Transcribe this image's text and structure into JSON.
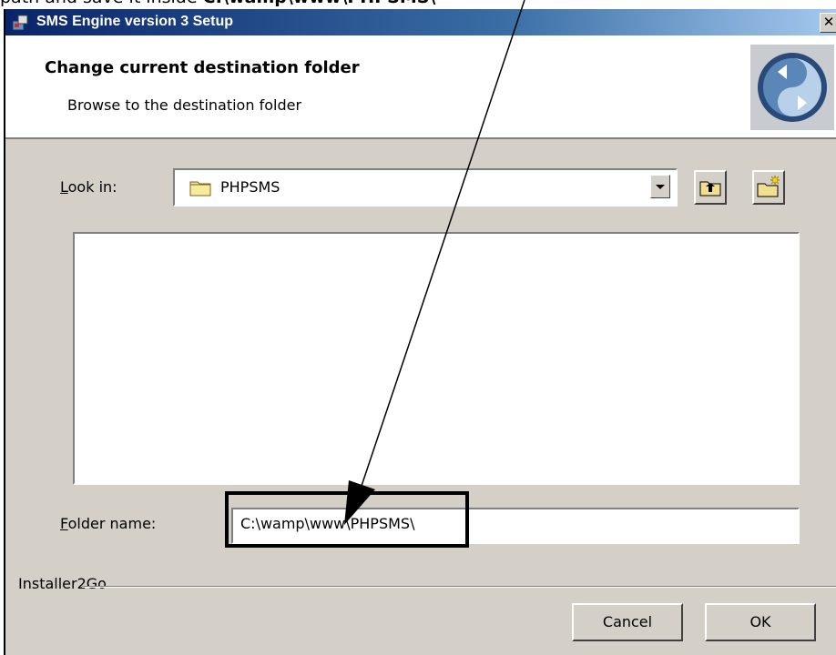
{
  "caption": {
    "prefix": "path and save it  inside  ",
    "path": "C:\\wamp\\www\\PHPSMS\\"
  },
  "window": {
    "title": "SMS Engine version 3 Setup",
    "close_glyph": "✕"
  },
  "header": {
    "title": "Change current destination folder",
    "subtitle": "Browse to the destination folder",
    "logo_icon": "installer-logo-icon"
  },
  "look_in": {
    "label_accel": "L",
    "label_rest": "ook in:",
    "value": "PHPSMS"
  },
  "folder_name": {
    "label_accel": "F",
    "label_rest": "older name:",
    "value": "C:\\wamp\\www\\PHPSMS\\"
  },
  "footer": {
    "group_label": "Installer2Go",
    "cancel_label": "Cancel",
    "ok_label": "OK"
  },
  "colors": {
    "dialog_bg": "#d4d0c8",
    "title_gradient_start": "#0a246a",
    "title_gradient_end": "#a6caf0",
    "annotation": "#000000"
  }
}
